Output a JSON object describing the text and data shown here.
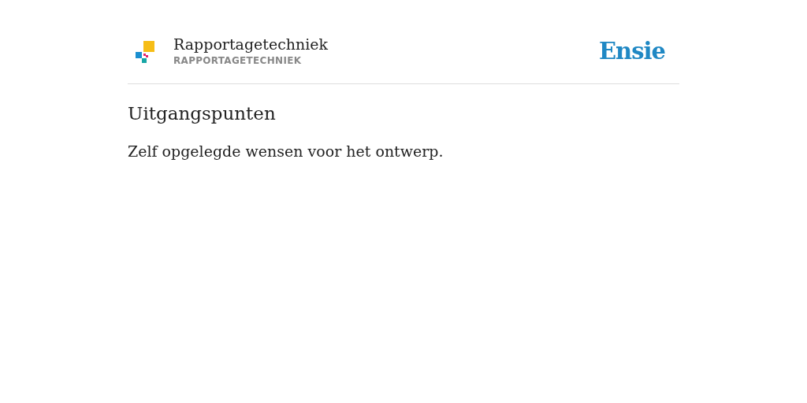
{
  "header": {
    "title": "Rapportagetechniek",
    "subtitle": "RAPPORTAGETECHNIEK",
    "brand": "Ensie"
  },
  "heading": "Uitgangspunten",
  "body": "Zelf opgelegde wensen voor het ontwerp."
}
